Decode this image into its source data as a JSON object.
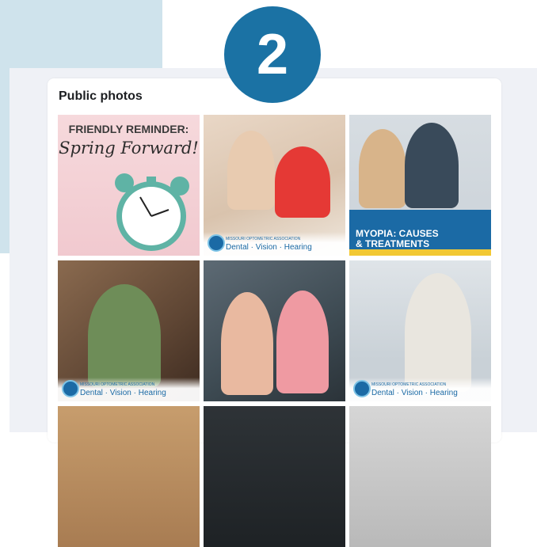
{
  "badge": {
    "number": "2"
  },
  "card": {
    "title": "Public photos"
  },
  "tiles": [
    {
      "heading": "FRIENDLY REMINDER:",
      "subheading": "Spring Forward!"
    },
    {
      "brand_small": "MISSOURI OPTOMETRIC ASSOCIATION",
      "brand_text": "Dental · Vision · Hearing"
    },
    {
      "title": "MYOPIA: CAUSES & TREATMENTS"
    },
    {
      "brand_small": "MISSOURI OPTOMETRIC ASSOCIATION",
      "brand_text": "Dental · Vision · Hearing"
    },
    {},
    {
      "brand_small": "MISSOURI OPTOMETRIC ASSOCIATION",
      "brand_text": "Dental · Vision · Hearing"
    }
  ],
  "colors": {
    "badge": "#1b72a4",
    "brand": "#1b6aa5",
    "accent_stripe": "#f2c833"
  }
}
